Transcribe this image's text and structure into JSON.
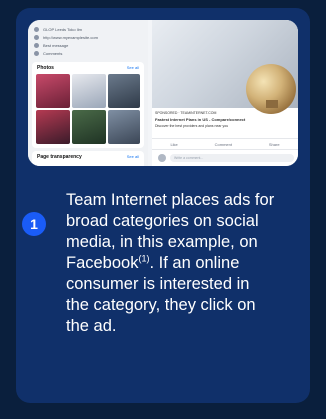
{
  "screenshot": {
    "info_rows": [
      "GLOP Leeds Toko Ilm",
      "http://www.myexamplesite.com",
      "Best message",
      "Comments"
    ],
    "photos_panel": {
      "title": "Photos",
      "see_all": "See all"
    },
    "transparency_panel": {
      "title": "Page transparency",
      "see_all": "See all"
    },
    "post": {
      "caption_lines": [
        "SPONSORED · TEAMINTERNET.COM",
        "Fastest Internet Plans in US - Compare/connect",
        "Discover the best providers and plans near you"
      ],
      "actions": [
        "Like",
        "Comment",
        "Share"
      ],
      "comment_placeholder": "Write a comment..."
    }
  },
  "step": {
    "number": "1",
    "text_before": "Team Internet places ads for broad categories on social media, in this example, on Facebook",
    "footnote": "(1)",
    "text_after": ". If an online consumer is interested in the category, they click on the ad."
  },
  "colors": {
    "page_bg": "#0a1f3d",
    "card_bg": "#10306a",
    "badge": "#1a5cf7",
    "text": "#ffffff"
  }
}
